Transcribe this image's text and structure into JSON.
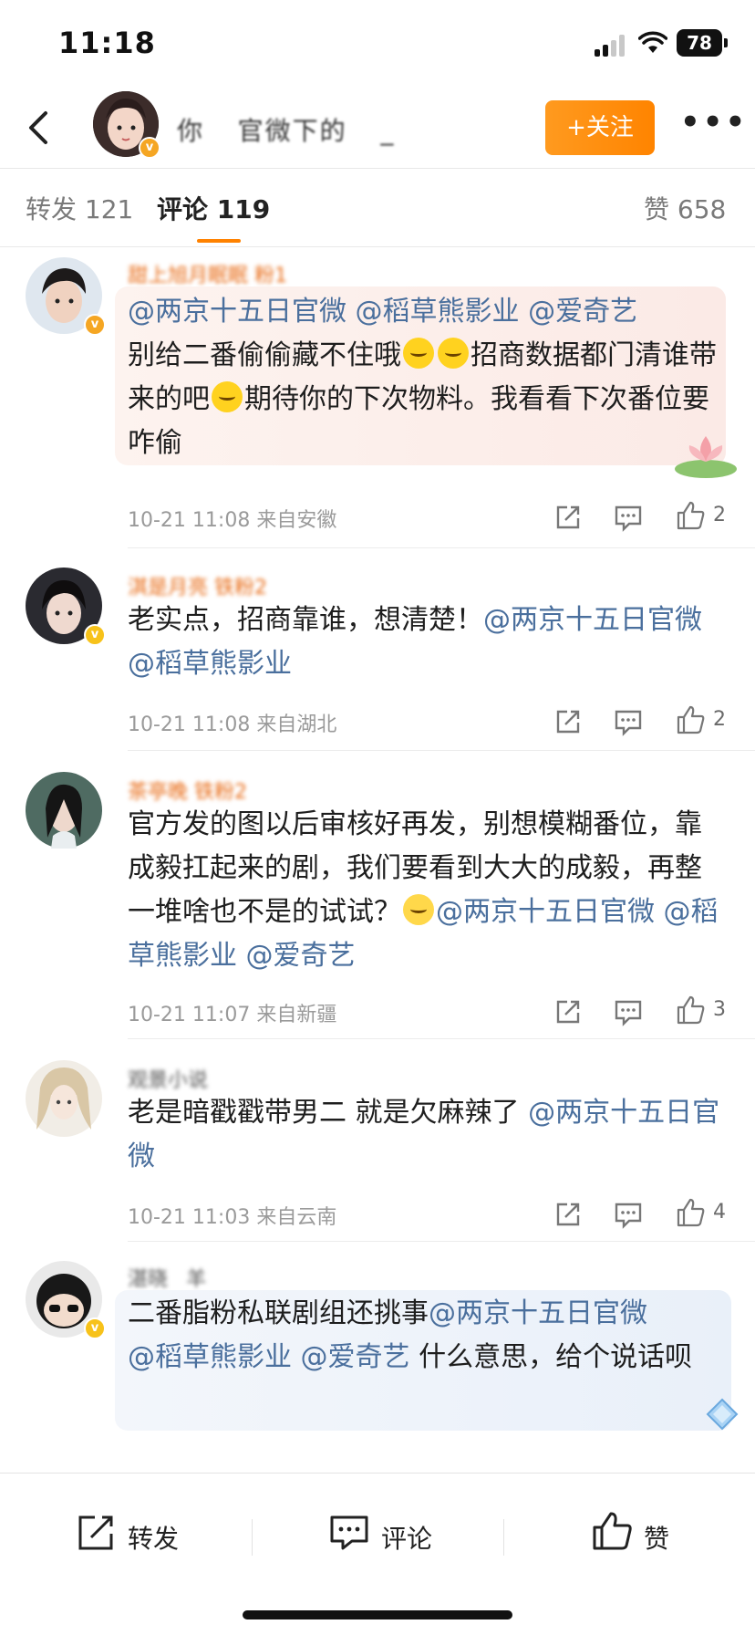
{
  "status_bar": {
    "time": "11:18",
    "battery": "78"
  },
  "header": {
    "back_icon": "chevron-left-icon",
    "author_name": "你ㅤ 官微下的ㅤ _",
    "follow_label": "+关注",
    "more_icon": "more-dots-icon"
  },
  "tabs": {
    "repost": "转发 121",
    "comment": "评论 119",
    "likes": "赞 658"
  },
  "comments": [
    {
      "user": "甜上旭月眠眠 粉1",
      "body_mentions": [
        "@两京十五日官微",
        "@稻草熊影业",
        "@爱奇艺"
      ],
      "body_line_a": "别给二番偷偷藏不住哦",
      "body_line_b": "招商数据都门清谁带来的吧",
      "body_line_c": "期待你的下次物料。我看看下次番位要咋偷",
      "time": "10-21 11:08",
      "location": "来自安徽",
      "likes": "2"
    },
    {
      "user": "淇是月亮 铁粉2",
      "body_text": "老实点，招商靠谁，想清楚！",
      "body_mentions": [
        "@两京十五日官微",
        "@稻草熊影业"
      ],
      "time": "10-21 11:08",
      "location": "来自湖北",
      "likes": "2"
    },
    {
      "user": "茶亭晚 铁粉2",
      "body_text": "官方发的图以后审核好再发，别想模糊番位，靠成毅扛起来的剧，我们要看到大大的成毅，再整一堆啥也不是的试试？",
      "body_mentions": [
        "@两京十五日官微",
        "@稻草熊影业",
        "@爱奇艺"
      ],
      "time": "10-21 11:07",
      "location": "来自新疆",
      "likes": "3"
    },
    {
      "user": "观景小说",
      "body_text": "老是暗戳戳带男二 就是欠麻辣了",
      "body_mentions": [
        "@两京十五日官微"
      ],
      "time": "10-21 11:03",
      "location": "来自云南",
      "likes": "4"
    },
    {
      "user": "湛晓ㅤ羊",
      "body_text_a": "二番脂粉私联剧组还挑事",
      "body_mentions": [
        "@两京十五日官微",
        "@稻草熊影业",
        "@爱奇艺"
      ],
      "body_text_b": "什么意思，给个说话呗"
    }
  ],
  "bottom_bar": {
    "repost": "转发",
    "comment": "评论",
    "like": "赞"
  },
  "colors": {
    "accent": "#ff8200",
    "mention": "#4a6f9d",
    "username": "#e86a14",
    "meta": "#9a9a9a"
  }
}
